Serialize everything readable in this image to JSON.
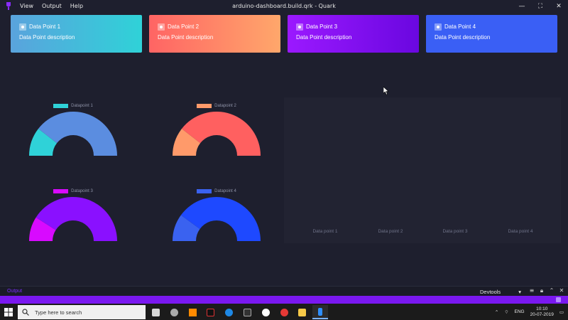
{
  "window": {
    "title": "arduino-dashboard.build.qrk - Quark",
    "menu": [
      "View",
      "Output",
      "Help"
    ],
    "controls": [
      "minimize",
      "maximize",
      "close"
    ]
  },
  "cards": [
    {
      "title": "Data Point 1",
      "description": "Data Point description",
      "colors": [
        "#5aa3dd",
        "#2fd2d8"
      ]
    },
    {
      "title": "Data Point 2",
      "description": "Data Point description",
      "colors": [
        "#ff6464",
        "#ffa76b"
      ]
    },
    {
      "title": "Data Point 3",
      "description": "Data Point description",
      "colors": [
        "#9b19ff",
        "#6a07e0"
      ]
    },
    {
      "title": "Data Point 4",
      "description": "Data Point description",
      "colors": [
        "#3a5ff5",
        "#3a5ff5"
      ]
    }
  ],
  "gauges": [
    {
      "legend": "Datapoint 1",
      "value": 0.21,
      "fill": "#5b8de0",
      "rest": "#2fd2d8"
    },
    {
      "legend": "Datapoint 2",
      "value": 0.21,
      "fill": "#ff6060",
      "rest": "#ff9a6a"
    },
    {
      "legend": "Datapoint 3",
      "value": 0.18,
      "fill": "#8a10ff",
      "rest": "#d80aff"
    },
    {
      "legend": "Datapoint 4",
      "value": 0.2,
      "fill": "#1e49ff",
      "rest": "#3a62f0"
    }
  ],
  "bar_panel": {
    "labels": [
      "Data point 1",
      "Data point 2",
      "Data point 3",
      "Data point 4"
    ]
  },
  "output": {
    "label": "Output",
    "devtools": "Devtools"
  },
  "taskbar": {
    "search_placeholder": "Type here to search",
    "language": "ENG",
    "time": "10:10",
    "date": "20-07-2019"
  }
}
